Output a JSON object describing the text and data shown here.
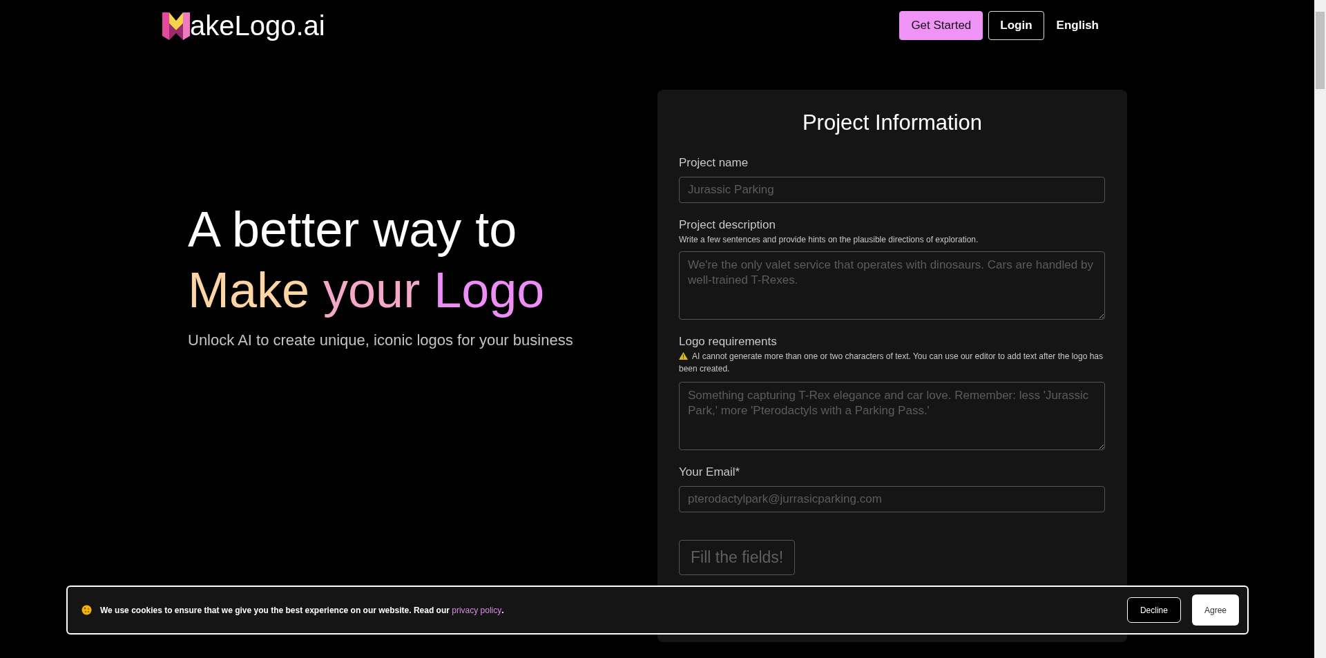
{
  "header": {
    "logo_text": "akeLogo.ai",
    "nav": [
      {
        "label": "Get Started",
        "kind": "primary"
      },
      {
        "label": "Login",
        "kind": "outline"
      },
      {
        "label": "English",
        "kind": "link"
      }
    ]
  },
  "hero": {
    "line_1": "A better way to",
    "line_2": [
      {
        "text": "Make",
        "color": "#fcd5a6"
      },
      {
        "text": "your",
        "color": "#f5a8c8"
      },
      {
        "text": "Logo",
        "color": "#ec8ef5"
      }
    ],
    "subtitle": "Unlock AI to create unique, iconic logos for your business"
  },
  "form": {
    "title": "Project Information",
    "fields": [
      {
        "kind": "input",
        "label": "Project name",
        "placeholder": "Jurassic Parking"
      },
      {
        "kind": "textarea",
        "label": "Project description",
        "hint": "Write a few sentences and provide hints on the plausible directions of exploration.",
        "placeholder": "We're the only valet service that operates with dinosaurs. Cars are handled by well-trained T-Rexes."
      },
      {
        "kind": "textarea",
        "label": "Logo requirements",
        "warning": "AI cannot generate more than one or two characters of text. You can use our editor to add text after the logo has been created.",
        "placeholder": "Something capturing T-Rex elegance and car love. Remember: less 'Jurassic Park,' more 'Pterodactyls with a Parking Pass.'"
      },
      {
        "kind": "input",
        "label": "Your Email*",
        "placeholder": "pterodactylpark@jurrasicparking.com"
      }
    ],
    "submit": {
      "label": "Fill the fields!",
      "disabled": true
    }
  },
  "cookie_banner": {
    "text": "We use cookies to ensure that we give you the best experience on our website. Read our ",
    "link": "privacy policy",
    "after_link": ".",
    "buttons": [
      {
        "label": "Decline",
        "kind": "outline"
      },
      {
        "label": "Agree",
        "kind": "solid"
      }
    ]
  }
}
